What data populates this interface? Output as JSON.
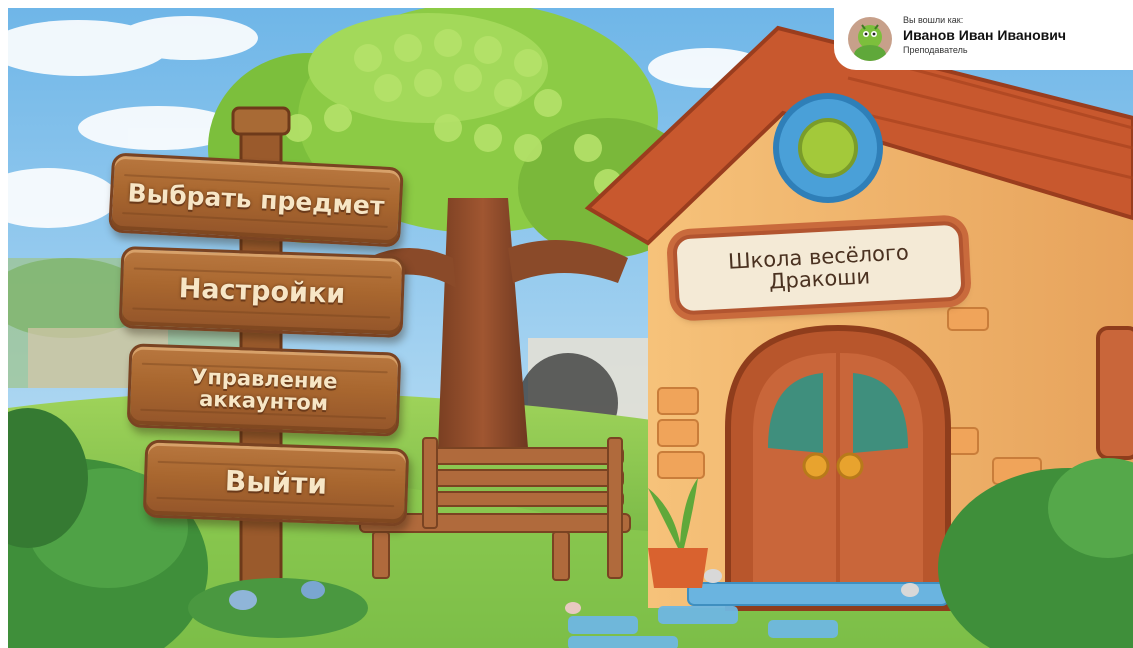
{
  "menu": {
    "choose_subject": "Выбрать предмет",
    "settings": "Настройки",
    "account_management": "Управление\nаккаунтом",
    "exit": "Выйти"
  },
  "school_sign": "Школа весёлого\nДракоши",
  "user": {
    "logged_in_as": "Вы вошли как:",
    "name": "Иванов Иван Иванович",
    "role": "Преподаватель"
  },
  "colors": {
    "wood": "#a9672f",
    "roof": "#c8582e",
    "wall": "#f2b46a",
    "grass": "#7cc243",
    "sky": "#8ec9ee"
  }
}
